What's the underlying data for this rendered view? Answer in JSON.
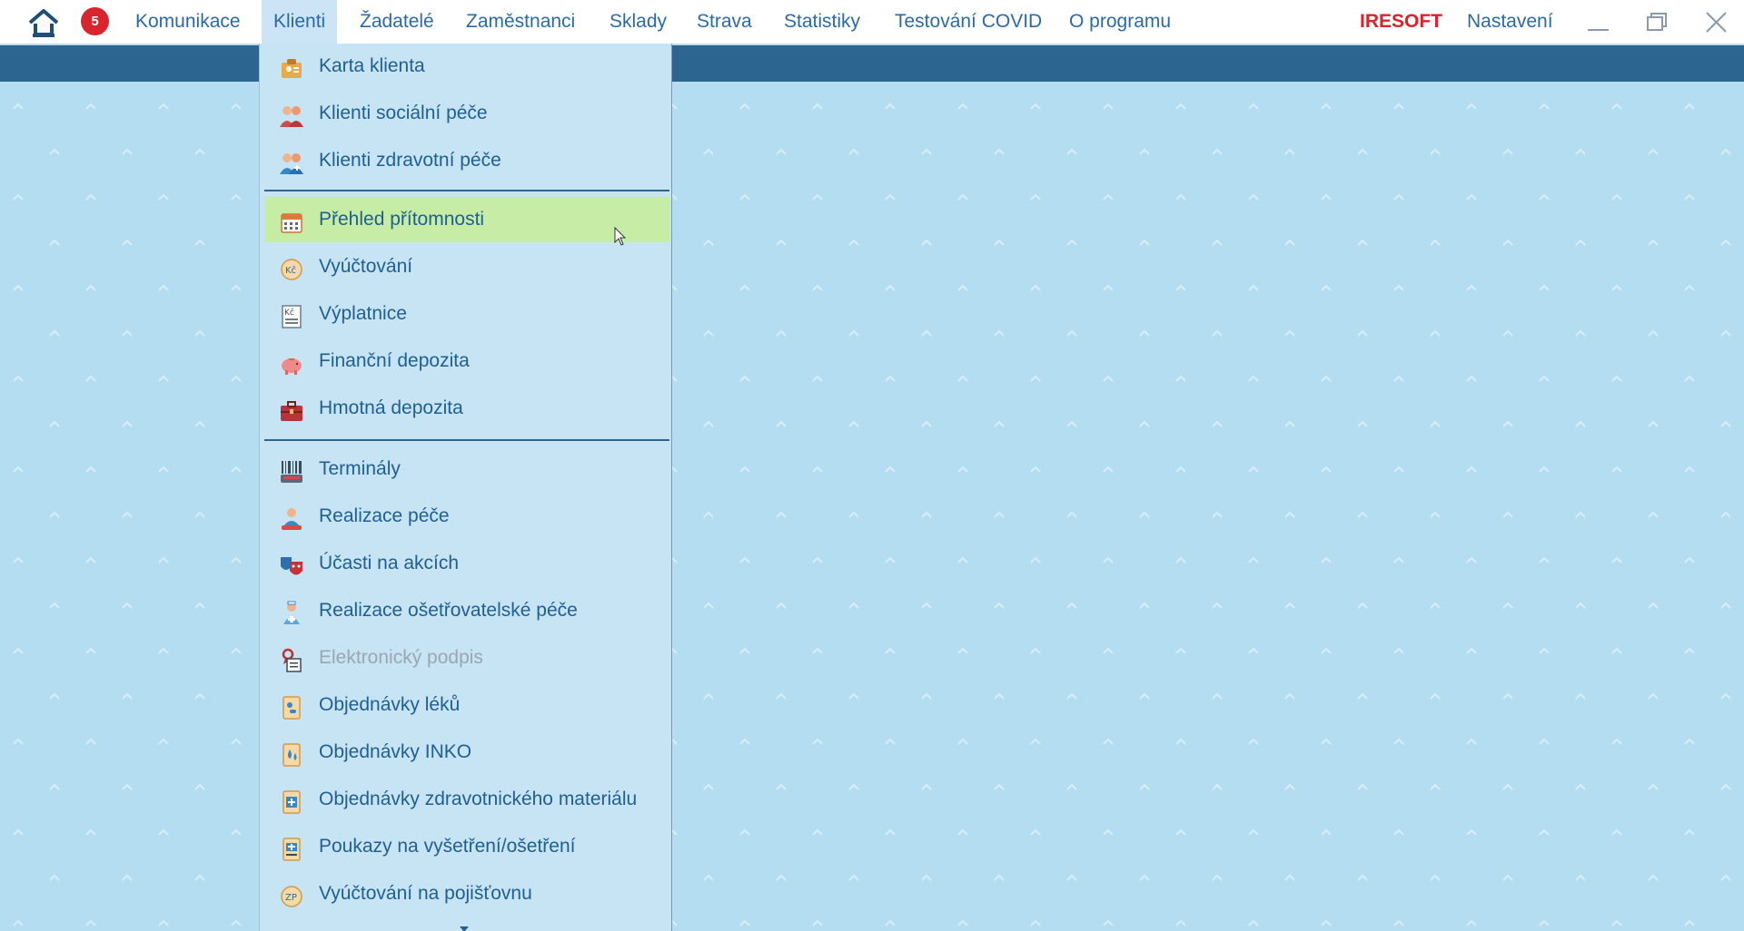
{
  "menubar": {
    "notification_count": "5",
    "items": [
      "Komunikace",
      "Klienti",
      "Žadatelé",
      "Zaměstnanci",
      "Sklady",
      "Strava",
      "Statistiky",
      "Testování COVID",
      "O programu"
    ],
    "active": "Klienti",
    "brand": "IRESOFT",
    "settings": "Nastavení"
  },
  "dropdown": {
    "group1": [
      "Karta klienta",
      "Klienti sociální péče",
      "Klienti zdravotní péče"
    ],
    "group2": [
      "Přehled přítomnosti",
      "Vyúčtování",
      "Výplatnice",
      "Finanční depozita",
      "Hmotná depozita"
    ],
    "group3": [
      "Terminály",
      "Realizace péče",
      "Účasti na akcích",
      "Realizace ošetřovatelské péče",
      "Elektronický podpis",
      "Objednávky léků",
      "Objednávky INKO",
      "Objednávky zdravotnického materiálu",
      "Poukazy na vyšetření/ošetření",
      "Vyúčtování na pojišťovnu"
    ],
    "highlighted": "Přehled přítomnosti",
    "disabled": "Elektronický podpis",
    "icons": {
      "karta": "id-card-icon",
      "socialni": "people-icon",
      "zdravotni": "medical-people-icon",
      "prehled": "calendar-icon",
      "vyuctovani": "kc-coin-icon",
      "vyplatnice": "kc-receipt-icon",
      "financni": "piggy-bank-icon",
      "hmotna": "briefcase-icon",
      "terminaly": "barcode-terminal-icon",
      "realizace": "caregiver-icon",
      "ucasti": "theater-masks-icon",
      "osetrovatelske": "nurse-icon",
      "podpis": "signature-certificate-icon",
      "leky": "pills-icon",
      "inko": "drops-icon",
      "material": "medical-kit-icon",
      "poukazy": "referral-icon",
      "pojistovna": "zp-insurance-icon"
    }
  }
}
